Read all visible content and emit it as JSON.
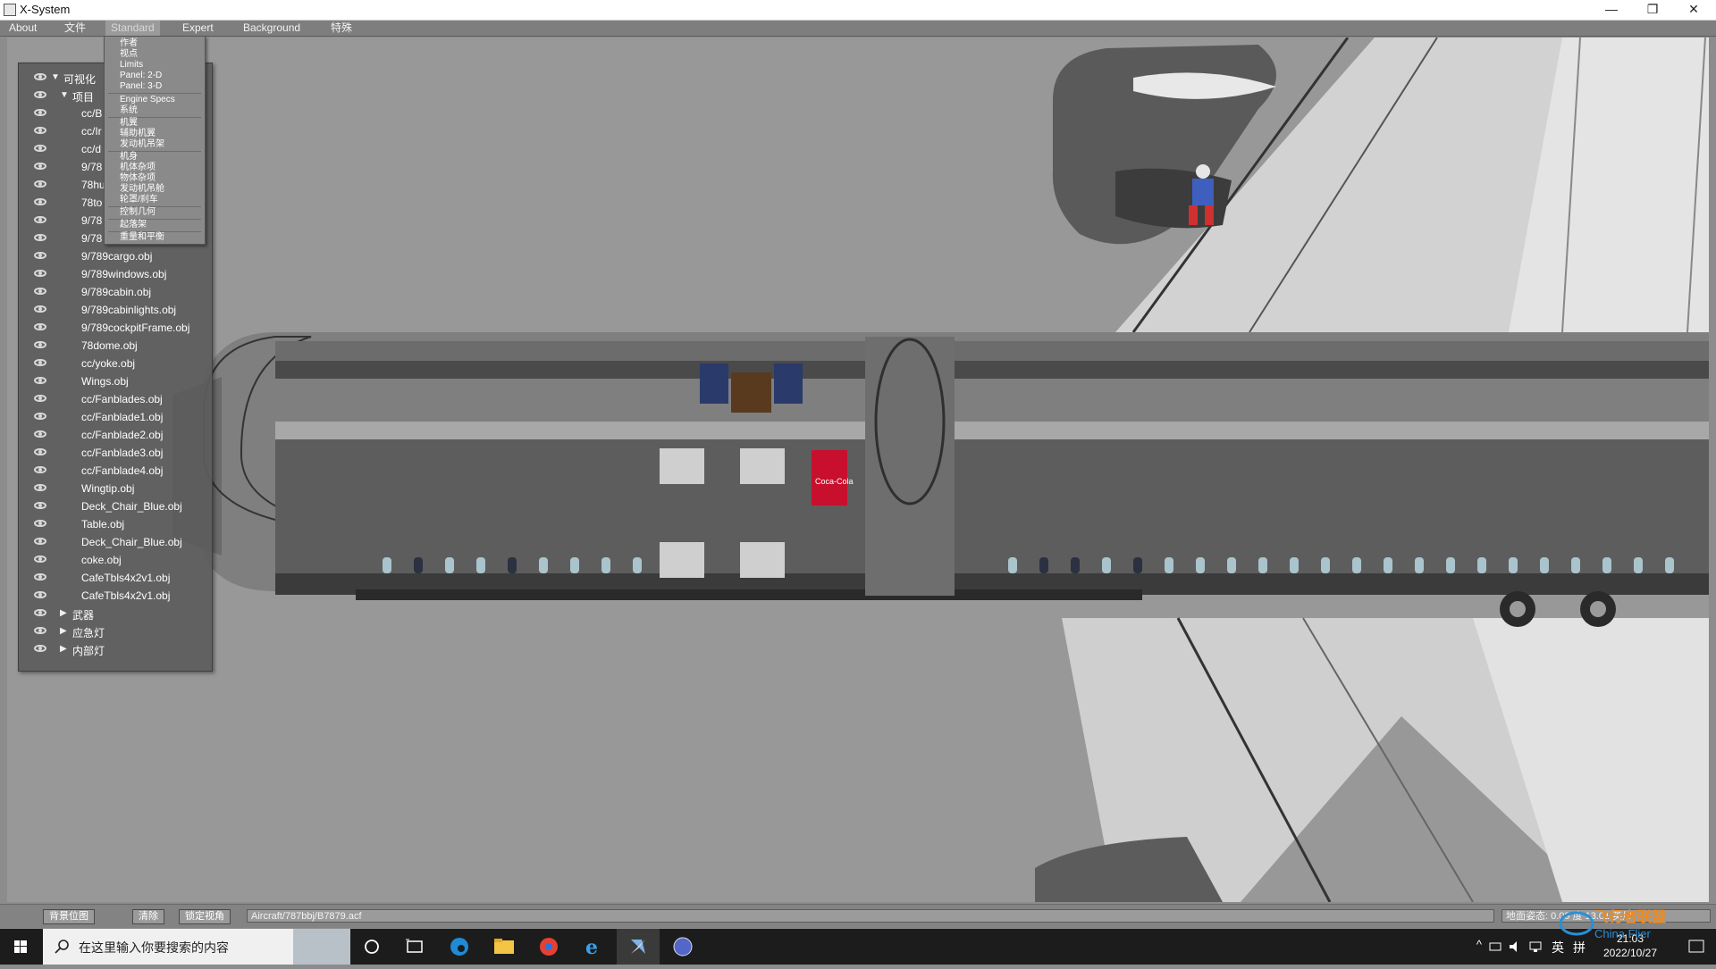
{
  "window": {
    "title": "X-System",
    "minimize": "—",
    "restore": "❐",
    "close": "✕"
  },
  "menubar": {
    "items": [
      "About",
      "文件",
      "Standard",
      "Expert",
      "Background",
      "特殊"
    ]
  },
  "standard_menu": {
    "items": [
      "作者",
      "视点",
      "Limits",
      "Panel: 2-D",
      "Panel: 3-D",
      "Engine Specs",
      "系统",
      "机翼",
      "辅助机翼",
      "发动机吊架",
      "机身",
      "机体杂项",
      "物体杂项",
      "发动机吊舱",
      "轮罩/刹车",
      "控制几何",
      "起落架",
      "重量和平衡"
    ]
  },
  "object_tree": {
    "rows": [
      {
        "label": "可视化",
        "arrow": "▼"
      },
      {
        "label": "项目",
        "arrow": "▼"
      },
      {
        "label": "cc/B"
      },
      {
        "label": "cc/Ir"
      },
      {
        "label": "cc/d"
      },
      {
        "label": "9/78"
      },
      {
        "label": "78hu"
      },
      {
        "label": "78to"
      },
      {
        "label": "9/78"
      },
      {
        "label": "9/78"
      },
      {
        "label": "9/789cargo.obj"
      },
      {
        "label": "9/789windows.obj"
      },
      {
        "label": "9/789cabin.obj"
      },
      {
        "label": "9/789cabinlights.obj"
      },
      {
        "label": "9/789cockpitFrame.obj"
      },
      {
        "label": "78dome.obj"
      },
      {
        "label": "cc/yoke.obj"
      },
      {
        "label": "Wings.obj"
      },
      {
        "label": "cc/Fanblades.obj"
      },
      {
        "label": "cc/Fanblade1.obj"
      },
      {
        "label": "cc/Fanblade2.obj"
      },
      {
        "label": "cc/Fanblade3.obj"
      },
      {
        "label": "cc/Fanblade4.obj"
      },
      {
        "label": "Wingtip.obj"
      },
      {
        "label": "Deck_Chair_Blue.obj"
      },
      {
        "label": "Table.obj"
      },
      {
        "label": "Deck_Chair_Blue.obj"
      },
      {
        "label": "coke.obj"
      },
      {
        "label": "CafeTbls4x2v1.obj"
      },
      {
        "label": "CafeTbls4x2v1.obj"
      },
      {
        "label": "武器",
        "arrow": "▶"
      },
      {
        "label": "应急灯",
        "arrow": "▶"
      },
      {
        "label": "内部灯",
        "arrow": "▶"
      }
    ]
  },
  "viewport": {
    "coke_label": "Coca-Cola"
  },
  "statusbar": {
    "btn_background": "背景位图",
    "btn_clear": "清除",
    "btn_lock": "锁定视角",
    "path": "Aircraft/787bbj/B7879.acf",
    "attitude": "地面姿态: 0.09 度 13.01 英尺"
  },
  "taskbar": {
    "search_placeholder": "在这里输入你要搜索的内容",
    "time": "21:03",
    "date": "2022/10/27",
    "ime": "英",
    "ime_mode": "拼"
  },
  "watermark": {
    "cn": "飞行者联盟",
    "en": "China Flier"
  },
  "colors": {
    "menubar": "#7e7e7e",
    "viewport_bg": "#989898",
    "taskbar": "#1c1c1c",
    "coke_red": "#c8102e"
  }
}
